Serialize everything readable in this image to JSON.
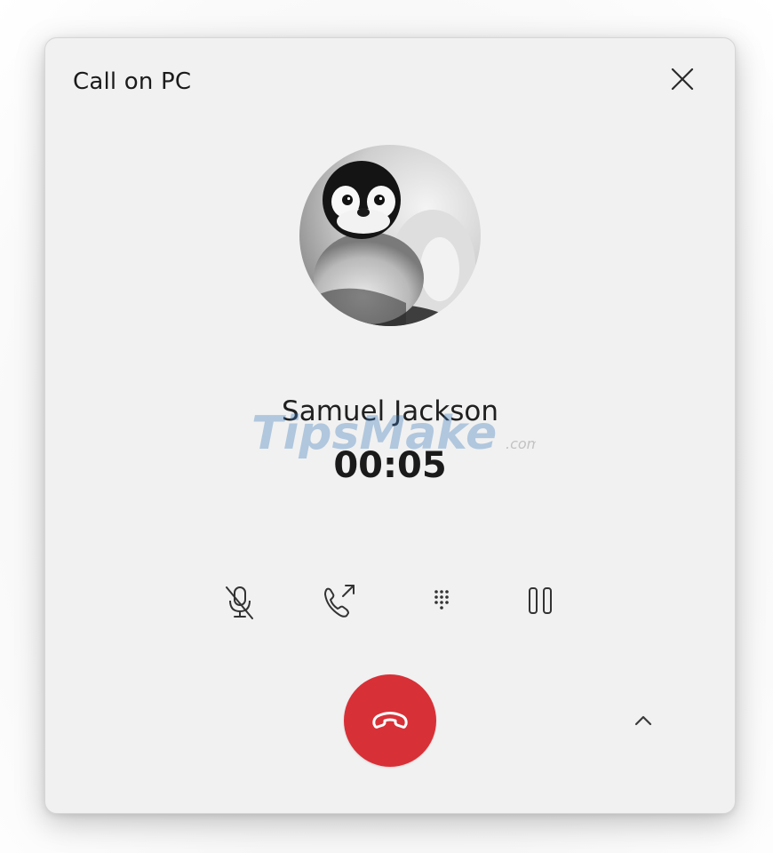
{
  "window": {
    "title": "Call on PC",
    "close_icon": "close-icon"
  },
  "contact": {
    "name": "Samuel Jackson",
    "avatar": "penguin-chick-photo"
  },
  "call": {
    "duration": "00:05"
  },
  "watermark": {
    "text": "TipsMake",
    "suffix": ".com"
  },
  "controls": [
    {
      "name": "mute",
      "icon": "microphone-off-icon"
    },
    {
      "name": "transfer",
      "icon": "phone-transfer-icon"
    },
    {
      "name": "keypad",
      "icon": "dialpad-icon"
    },
    {
      "name": "hold",
      "icon": "pause-icon"
    }
  ],
  "end_call": {
    "icon": "hang-up-icon",
    "color": "#d83037"
  },
  "expand": {
    "icon": "chevron-up-icon"
  }
}
